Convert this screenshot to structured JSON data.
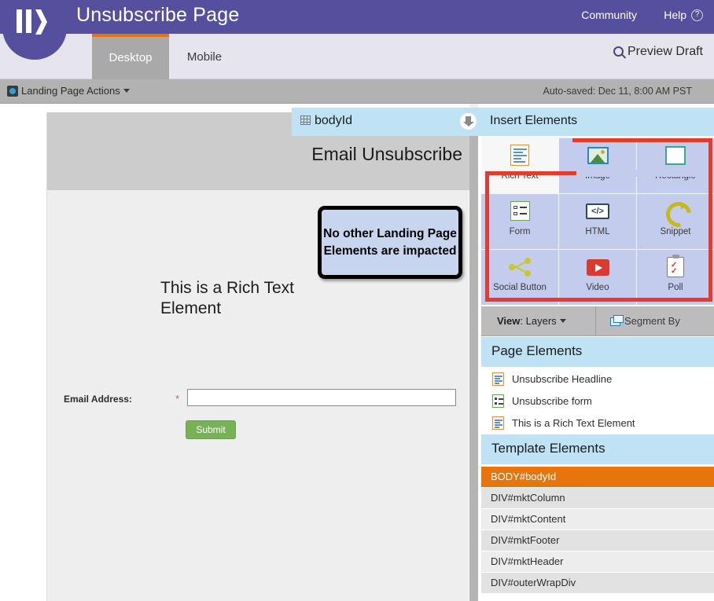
{
  "header": {
    "title": "Unsubscribe Page",
    "community_label": "Community",
    "help_label": "Help",
    "help_badge": "?",
    "logo_name": "marketo-logo"
  },
  "tabs": {
    "desktop": "Desktop",
    "mobile": "Mobile",
    "active": "Desktop",
    "preview_label": "Preview Draft"
  },
  "actionbar": {
    "actions_label": "Landing Page Actions",
    "autosave": "Auto-saved: Dec 11, 8:00 AM PST"
  },
  "bodyid_bar": {
    "label": "bodyId",
    "insert_title": "Insert Elements"
  },
  "canvas": {
    "headline": "Email Unsubscribe",
    "rich_text": "This is a Rich Text Element",
    "form": {
      "email_label": "Email Address:",
      "required_mark": "*",
      "email_value": "",
      "email_placeholder": "",
      "submit_label": "Submit"
    }
  },
  "annotation": {
    "callout_text": "No other Landing Page Elements are impacted",
    "callout_bg": "#c7d6ee",
    "highlight_color": "#e23b30"
  },
  "insert_elements": [
    {
      "label": "Rich Text",
      "icon": "rich-text-icon",
      "highlighted": false
    },
    {
      "label": "Image",
      "icon": "image-icon",
      "highlighted": true
    },
    {
      "label": "Rectangle",
      "icon": "rectangle-icon",
      "highlighted": true
    },
    {
      "label": "Form",
      "icon": "form-icon",
      "highlighted": true
    },
    {
      "label": "HTML",
      "icon": "html-icon",
      "highlighted": true
    },
    {
      "label": "Snippet",
      "icon": "snippet-icon",
      "highlighted": true
    },
    {
      "label": "Social Button",
      "icon": "social-button-icon",
      "highlighted": true
    },
    {
      "label": "Video",
      "icon": "video-icon",
      "highlighted": true
    },
    {
      "label": "Poll",
      "icon": "poll-icon",
      "highlighted": true
    }
  ],
  "viewbar": {
    "view_prefix": "View",
    "view_value": "Layers",
    "segment_label": "Segment By"
  },
  "page_elements": {
    "title": "Page Elements",
    "items": [
      {
        "label": "Unsubscribe Headline",
        "icon": "rich-text-icon"
      },
      {
        "label": "Unsubscribe form",
        "icon": "form-icon"
      },
      {
        "label": "This is a Rich Text Element",
        "icon": "rich-text-icon"
      }
    ]
  },
  "template_elements": {
    "title": "Template Elements",
    "items": [
      {
        "label": "BODY#bodyId",
        "selected": true
      },
      {
        "label": "DIV#mktColumn",
        "selected": false
      },
      {
        "label": "DIV#mktContent",
        "selected": false
      },
      {
        "label": "DIV#mktFooter",
        "selected": false
      },
      {
        "label": "DIV#mktHeader",
        "selected": false
      },
      {
        "label": "DIV#outerWrapDiv",
        "selected": false
      }
    ]
  },
  "colors": {
    "brand_purple": "#564f9e",
    "tab_active_orange": "#e8740c",
    "panel_blue": "#bfe2f5",
    "selected_orange": "#e8740c",
    "submit_green": "#77b259",
    "highlight_lavender": "#c4cced"
  }
}
